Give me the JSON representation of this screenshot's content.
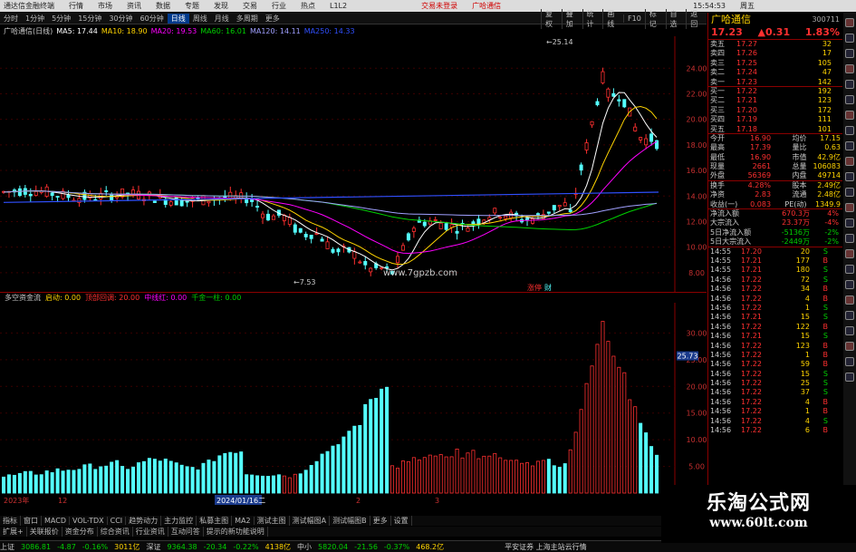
{
  "titlebar": {
    "app": "通达信金融终端",
    "menus": [
      "行情",
      "市场",
      "资讯",
      "数据",
      "专题",
      "发现",
      "交易",
      "行业",
      "热点",
      "L1L2"
    ],
    "trade_login": "交易未登录",
    "stock": "广哈通信",
    "clock": "15:54:53",
    "weekday": "周五"
  },
  "timeframes": [
    "分时",
    "1分钟",
    "5分钟",
    "15分钟",
    "30分钟",
    "60分钟",
    "日线",
    "周线",
    "月线",
    "多周期",
    "更多"
  ],
  "active_timeframe": "日线",
  "right_toolbar": [
    "复权",
    "叠加",
    "统计",
    "画线",
    "F10",
    "标记",
    "自选",
    "返回"
  ],
  "ma_line": {
    "title": "广哈通信(日线)",
    "ma5": "MA5: 17.44",
    "ma10": "MA10: 18.90",
    "ma20": "MA20: 19.53",
    "ma60": "MA60: 16.01",
    "ma120": "MA120: 14.11",
    "ma250": "MA250: 14.33"
  },
  "colors": {
    "ma5": "#ffffff",
    "ma10": "#ffd400",
    "ma20": "#ff00ff",
    "ma60": "#00d000",
    "ma120": "#a0a0ff",
    "ma250": "#3050ff",
    "up": "#ff3030",
    "down": "#54ffff"
  },
  "price_axis": [
    "24.00",
    "22.00",
    "20.00",
    "18.00",
    "16.00",
    "14.00",
    "12.00",
    "10.00",
    "8.00"
  ],
  "price_annotations": {
    "high": "25.14",
    "low": "7.53"
  },
  "watermark": "www.7gpzb.com",
  "mark_label": "涨停",
  "mark_label2": "财",
  "sub": {
    "title": "多空资金流",
    "items": [
      {
        "t": "启动: 0.00",
        "c": "#ffd400"
      },
      {
        "t": "顶部回调: 20.00",
        "c": "#ff3030"
      },
      {
        "t": "中线红: 0.00",
        "c": "#ff00ff"
      },
      {
        "t": "千金一柱: 0.00",
        "c": "#00d000"
      }
    ]
  },
  "sub_axis": [
    "30.00",
    "25.00",
    "20.00",
    "15.00",
    "10.00",
    "5.00"
  ],
  "sub_current": "25.73",
  "time_axis": {
    "year": "2023年",
    "m12": "12",
    "date": "2024/01/16二",
    "m2": "2",
    "m3": "3"
  },
  "bottom_tabs": [
    "指标",
    "窗口",
    "MACD",
    "VOL-TDX",
    "CCI",
    "趋势动力",
    "主力监控",
    "私募主图",
    "MA2",
    "测试主图",
    "测试幅图A",
    "测试幅图B",
    "更多",
    "设置"
  ],
  "bottom_tabs2": [
    "扩展+",
    "关联报价",
    "资金分布",
    "综合资讯",
    "行业资讯",
    "互动问答",
    "提示的新功能说明"
  ],
  "status": [
    {
      "name": "上证",
      "val": "3086.81",
      "chg": "-4.87",
      "pct": "-0.16%",
      "amt": "3011亿"
    },
    {
      "name": "深证",
      "val": "9364.38",
      "chg": "-20.34",
      "pct": "-0.22%",
      "amt": "4138亿"
    },
    {
      "name": "中小",
      "val": "5820.04",
      "chg": "-21.56",
      "pct": "-0.37%",
      "amt": "468.2亿"
    }
  ],
  "status_right": "平安证券 上海主站云行情",
  "quote": {
    "name": "广哈通信",
    "code": "300711",
    "price": "17.23",
    "change": "▲0.31",
    "pct": "1.83%"
  },
  "order_book": [
    {
      "label": "卖五",
      "price": "17.27",
      "vol": "32"
    },
    {
      "label": "卖四",
      "price": "17.26",
      "vol": "17"
    },
    {
      "label": "卖三",
      "price": "17.25",
      "vol": "105"
    },
    {
      "label": "卖二",
      "price": "17.24",
      "vol": "47"
    },
    {
      "label": "卖一",
      "price": "17.23",
      "vol": "142"
    },
    {
      "label": "买一",
      "price": "17.22",
      "vol": "192"
    },
    {
      "label": "买二",
      "price": "17.21",
      "vol": "123"
    },
    {
      "label": "买三",
      "price": "17.20",
      "vol": "172"
    },
    {
      "label": "买四",
      "price": "17.19",
      "vol": "111"
    },
    {
      "label": "买五",
      "price": "17.18",
      "vol": "101"
    }
  ],
  "stats": [
    {
      "l1": "今开",
      "v1": "16.90",
      "l2": "均价",
      "v2": "17.15"
    },
    {
      "l1": "最高",
      "v1": "17.39",
      "l2": "量比",
      "v2": "0.63"
    },
    {
      "l1": "最低",
      "v1": "16.90",
      "l2": "市值",
      "v2": "42.9亿"
    },
    {
      "l1": "现量",
      "v1": "2661",
      "l2": "总量",
      "v2": "106083"
    },
    {
      "l1": "外盘",
      "v1": "56369",
      "l2": "内盘",
      "v2": "49714"
    },
    {
      "l1": "换手",
      "v1": "4.28%",
      "l2": "股本",
      "v2": "2.49亿"
    },
    {
      "l1": "净资",
      "v1": "2.83",
      "l2": "流通",
      "v2": "2.48亿"
    },
    {
      "l1": "收益(一)",
      "v1": "0.083",
      "l2": "PE(动)",
      "v2": "1349.9"
    }
  ],
  "flows": [
    {
      "l": "净流入额",
      "v": "670.3万",
      "p": "4%",
      "c": "#ff3030"
    },
    {
      "l": "大宗流入",
      "v": "23.37万",
      "p": "-4%",
      "c": "#ff3030"
    },
    {
      "l": "5日净流入额",
      "v": "-5136万",
      "p": "-2%",
      "c": "#00d000"
    },
    {
      "l": "5日大宗流入",
      "v": "-2449万",
      "p": "-2%",
      "c": "#00d000"
    }
  ],
  "ticks": [
    {
      "t": "14:55",
      "p": "17.20",
      "v": "20",
      "d": "S"
    },
    {
      "t": "14:55",
      "p": "17.21",
      "v": "177",
      "d": "B"
    },
    {
      "t": "14:55",
      "p": "17.21",
      "v": "180",
      "d": "S"
    },
    {
      "t": "14:56",
      "p": "17.22",
      "v": "72",
      "d": "S"
    },
    {
      "t": "14:56",
      "p": "17.22",
      "v": "34",
      "d": "B"
    },
    {
      "t": "14:56",
      "p": "17.22",
      "v": "4",
      "d": "B"
    },
    {
      "t": "14:56",
      "p": "17.22",
      "v": "1",
      "d": "S"
    },
    {
      "t": "14:56",
      "p": "17.21",
      "v": "15",
      "d": "S"
    },
    {
      "t": "14:56",
      "p": "17.22",
      "v": "122",
      "d": "B"
    },
    {
      "t": "14:56",
      "p": "17.21",
      "v": "15",
      "d": "S"
    },
    {
      "t": "14:56",
      "p": "17.22",
      "v": "123",
      "d": "B"
    },
    {
      "t": "14:56",
      "p": "17.22",
      "v": "1",
      "d": "B"
    },
    {
      "t": "14:56",
      "p": "17.22",
      "v": "59",
      "d": "B"
    },
    {
      "t": "14:56",
      "p": "17.22",
      "v": "15",
      "d": "S"
    },
    {
      "t": "14:56",
      "p": "17.22",
      "v": "25",
      "d": "S"
    },
    {
      "t": "14:56",
      "p": "17.22",
      "v": "37",
      "d": "S"
    },
    {
      "t": "14:56",
      "p": "17.22",
      "v": "4",
      "d": "B"
    },
    {
      "t": "14:56",
      "p": "17.22",
      "v": "1",
      "d": "B"
    },
    {
      "t": "14:56",
      "p": "17.22",
      "v": "4",
      "d": "S"
    },
    {
      "t": "14:56",
      "p": "17.22",
      "v": "6",
      "d": "B"
    }
  ],
  "logo": {
    "cn": "乐淘公式网",
    "url": "www.60lt.com"
  }
}
